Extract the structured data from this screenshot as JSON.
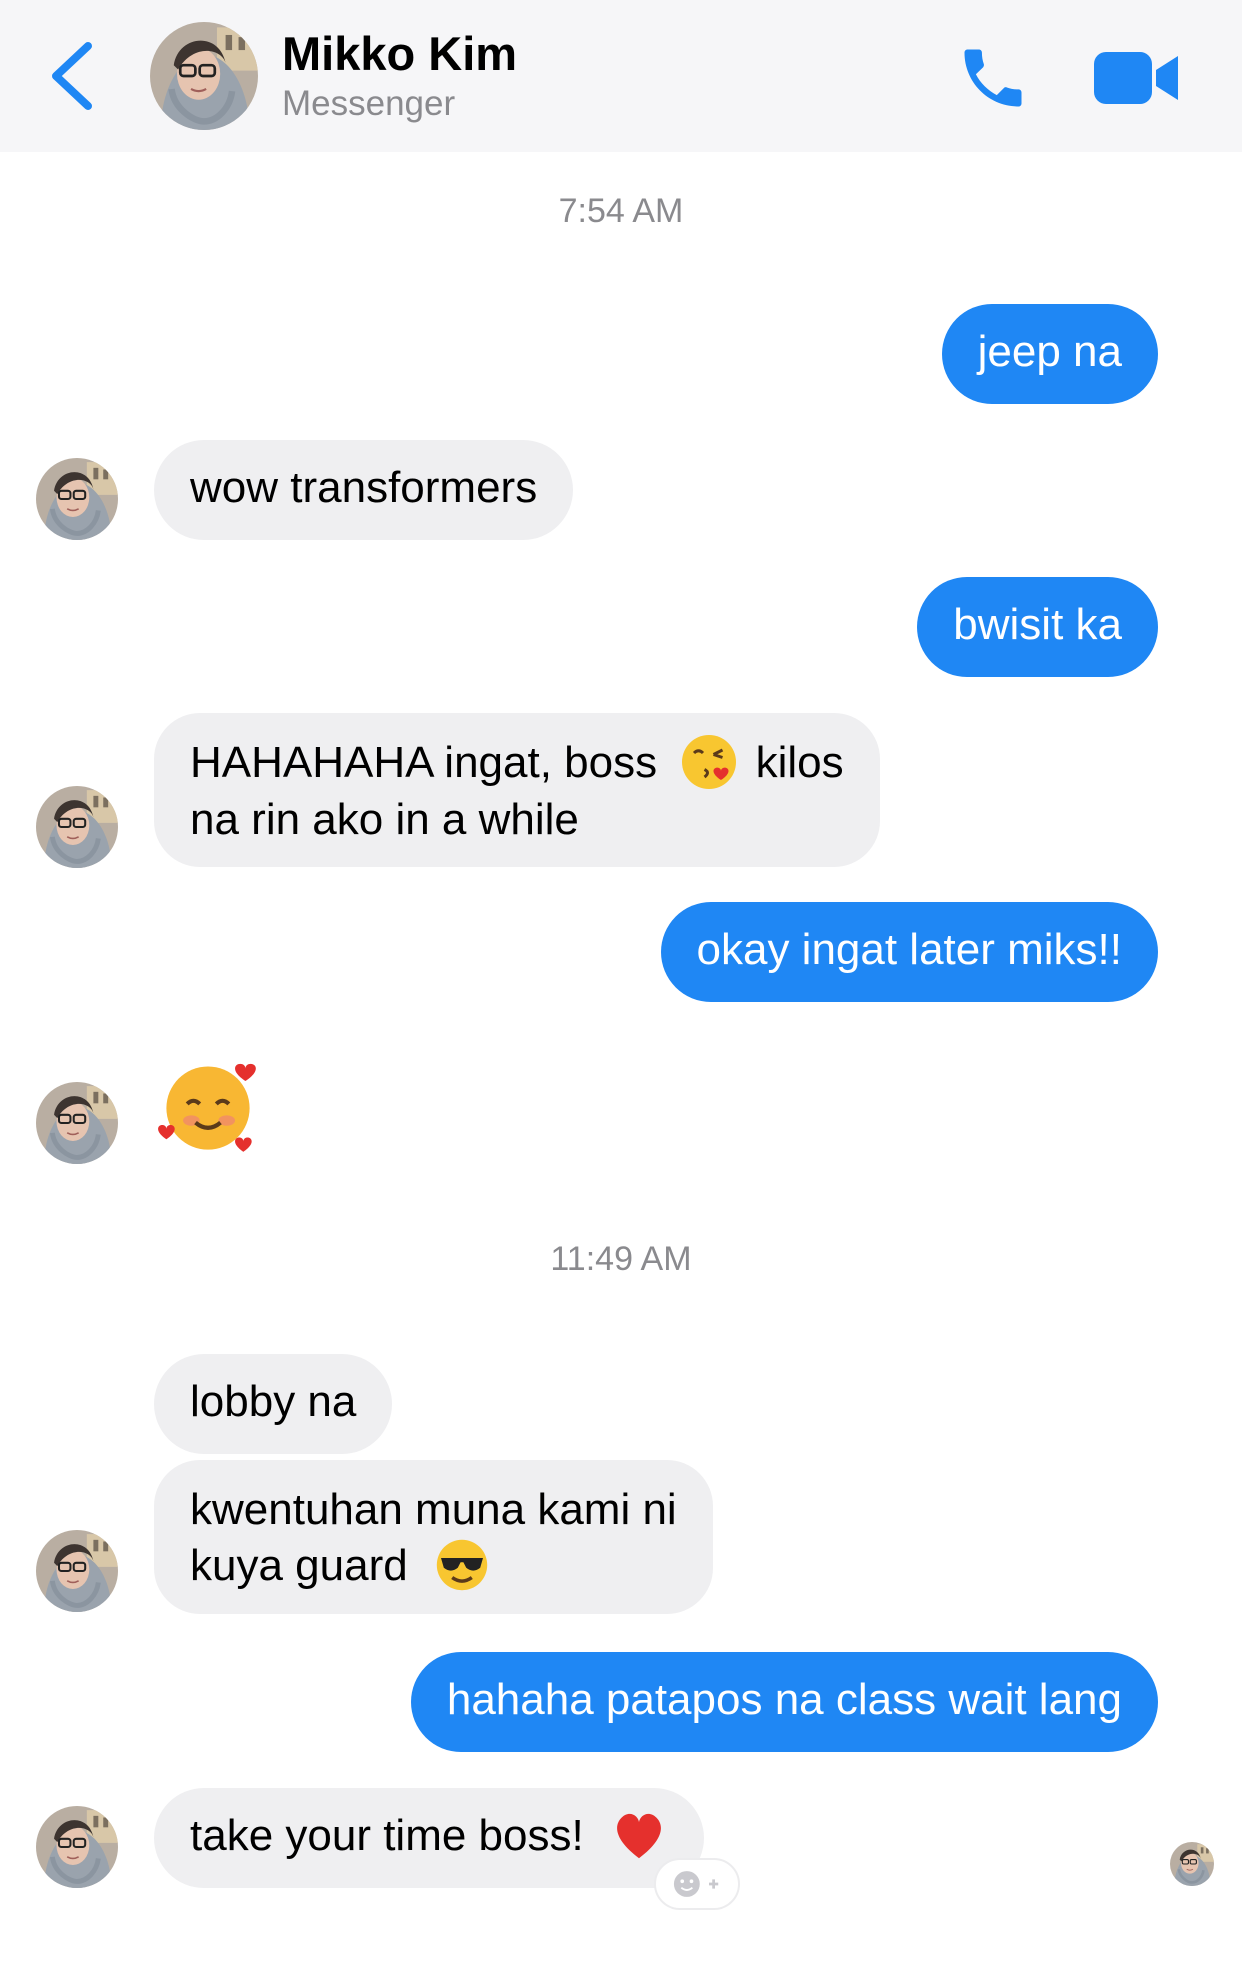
{
  "header": {
    "contact_name": "Mikko Kim",
    "subtitle": "Messenger",
    "back_icon": "chevron-left-icon",
    "call_icon": "phone-icon",
    "video_icon": "video-camera-icon"
  },
  "colors": {
    "accent": "#1f87f4",
    "incoming_bubble": "#efeff1",
    "header_bg": "#f6f6f8",
    "timestamp": "#8a8a8e"
  },
  "timestamps": [
    "7:54 AM",
    "11:49 AM"
  ],
  "messages": [
    {
      "from": "me",
      "text": "jeep na"
    },
    {
      "from": "Mikko Kim",
      "text": "wow transformers"
    },
    {
      "from": "me",
      "text": "bwisit ka"
    },
    {
      "from": "Mikko Kim",
      "line1": "HAHAHAHA ingat, boss",
      "emoji": "kissing-face-with-heart-emoji",
      "line1_end": " kilos",
      "line2": "na rin ako in a while"
    },
    {
      "from": "me",
      "text": "okay ingat later miks!!"
    },
    {
      "from": "Mikko Kim",
      "emoji": "smiling-face-with-hearts-emoji"
    },
    {
      "from": "Mikko Kim",
      "text": "lobby na"
    },
    {
      "from": "Mikko Kim",
      "line1": "kwentuhan muna kami ni",
      "line2": "kuya guard",
      "emoji": "sunglasses-face-emoji"
    },
    {
      "from": "me",
      "text": "hahaha patapos na class wait lang"
    },
    {
      "from": "Mikko Kim",
      "text": "take your time boss!",
      "emoji": "red-heart-emoji"
    }
  ],
  "reaction_button_icon": "add-reaction-icon"
}
